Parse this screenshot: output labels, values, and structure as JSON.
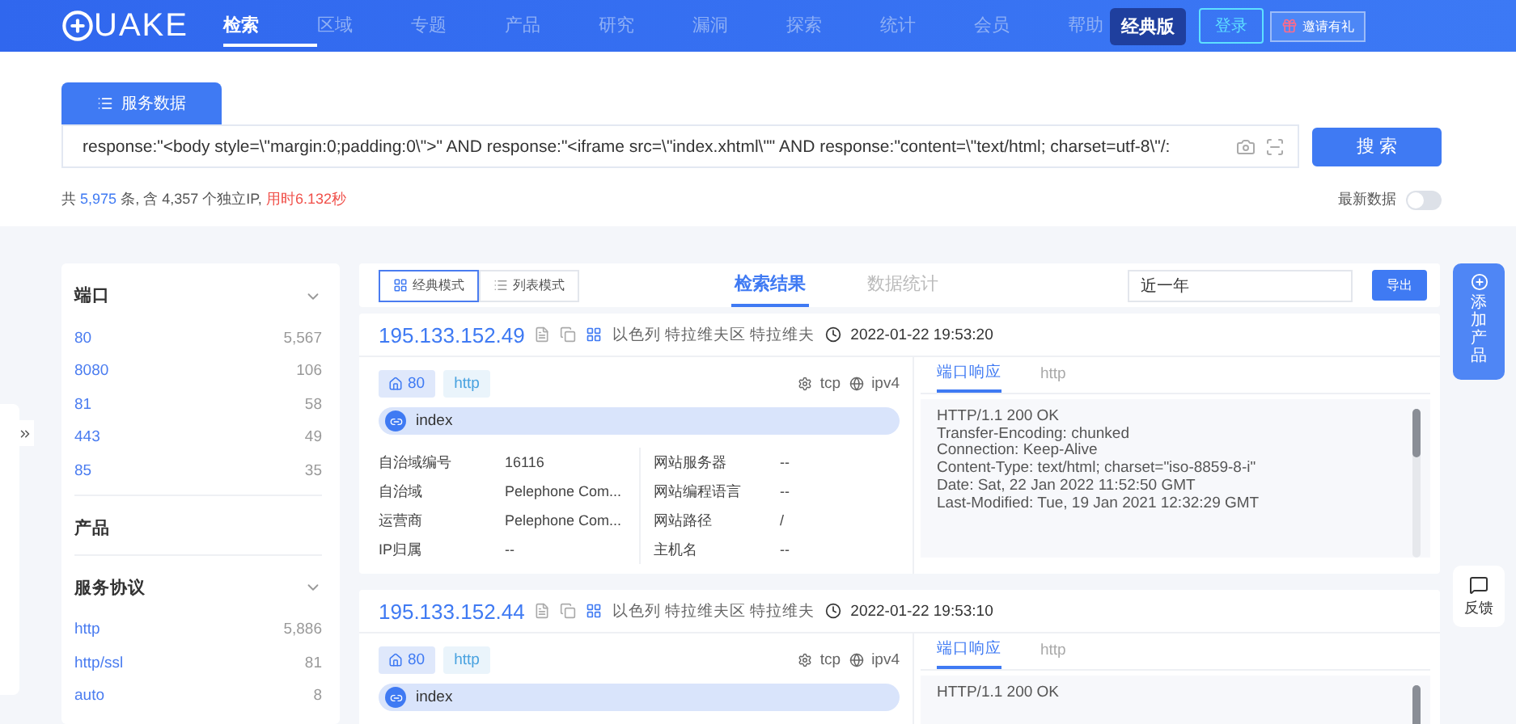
{
  "header": {
    "logo_text": "UAKE",
    "nav": [
      {
        "label": "检索",
        "selected": true
      },
      {
        "label": "区域",
        "selected": false
      },
      {
        "label": "专题",
        "selected": false
      },
      {
        "label": "产品",
        "selected": false
      },
      {
        "label": "研究",
        "selected": false
      },
      {
        "label": "漏洞",
        "selected": false
      },
      {
        "label": "探索",
        "selected": false
      },
      {
        "label": "统计",
        "selected": false
      },
      {
        "label": "会员",
        "selected": false
      },
      {
        "label": "帮助",
        "selected": false
      }
    ],
    "edition": "经典版",
    "login": "登录",
    "invite": "邀请有礼"
  },
  "search": {
    "tab": "服务数据",
    "query": "response:\"<body style=\\\"margin:0;padding:0\\\">\" AND response:\"<iframe src=\\\"index.xhtml\\\"\" AND response:\"content=\\\"text/html; charset=utf-8\\\"/:",
    "button": "搜 索",
    "stats": {
      "prefix": "共",
      "count": "5,975",
      "middle": "条, 含 4,357 个独立IP,",
      "time": "用时6.132秒"
    },
    "latest": {
      "label": "最新数据",
      "on": false
    }
  },
  "sidebar": [
    {
      "title": "端口",
      "kind": "list",
      "items": [
        {
          "label": "80",
          "count": "5,567"
        },
        {
          "label": "8080",
          "count": "106"
        },
        {
          "label": "81",
          "count": "58"
        },
        {
          "label": "443",
          "count": "49"
        },
        {
          "label": "85",
          "count": "35"
        }
      ]
    },
    {
      "title": "产品",
      "kind": "empty"
    },
    {
      "title": "服务协议",
      "kind": "list",
      "items": [
        {
          "label": "http",
          "count": "5,886"
        },
        {
          "label": "http/ssl",
          "count": "81"
        },
        {
          "label": "auto",
          "count": "8"
        }
      ]
    }
  ],
  "toolbar": {
    "views": [
      {
        "label": "经典模式",
        "selected": true
      },
      {
        "label": "列表模式",
        "selected": false
      }
    ],
    "tabs": [
      {
        "label": "检索结果",
        "selected": true
      },
      {
        "label": "数据统计",
        "selected": false
      }
    ],
    "range": "近一年",
    "export": "导出"
  },
  "results": [
    {
      "ip": "195.133.152.49",
      "location": "以色列 特拉维夫区 特拉维夫",
      "time": "2022-01-22 19:53:20",
      "port": "80",
      "protocol": "http",
      "transport": "tcp",
      "ip_version": "ipv4",
      "title": "index",
      "left_fields": [
        {
          "label": "自治域编号",
          "value": "16116"
        },
        {
          "label": "自治域",
          "value": "Pelephone Com..."
        },
        {
          "label": "运营商",
          "value": "Pelephone Com..."
        },
        {
          "label": "IP归属",
          "value": "--"
        }
      ],
      "right_fields": [
        {
          "label": "网站服务器",
          "value": "--"
        },
        {
          "label": "网站编程语言",
          "value": "--"
        },
        {
          "label": "网站路径",
          "value": "/"
        },
        {
          "label": "主机名",
          "value": "--"
        }
      ],
      "response_tabs": [
        {
          "label": "端口响应",
          "selected": true
        },
        {
          "label": "http",
          "selected": false
        }
      ],
      "response_lines": [
        "HTTP/1.1 200 OK",
        "Transfer-Encoding: chunked",
        "Connection: Keep-Alive",
        "Content-Type: text/html; charset=\"iso-8859-8-i\"",
        "Date: Sat, 22 Jan 2022 11:52:50 GMT",
        "Last-Modified: Tue, 19 Jan 2021 12:32:29 GMT"
      ]
    },
    {
      "ip": "195.133.152.44",
      "location": "以色列 特拉维夫区 特拉维夫",
      "time": "2022-01-22 19:53:10",
      "port": "80",
      "protocol": "http",
      "transport": "tcp",
      "ip_version": "ipv4",
      "title": "index",
      "response_tabs": [
        {
          "label": "端口响应",
          "selected": true
        },
        {
          "label": "http",
          "selected": false
        }
      ],
      "response_lines": [
        "HTTP/1.1 200 OK"
      ]
    }
  ],
  "add_product": "添加产品",
  "feedback": "反馈"
}
